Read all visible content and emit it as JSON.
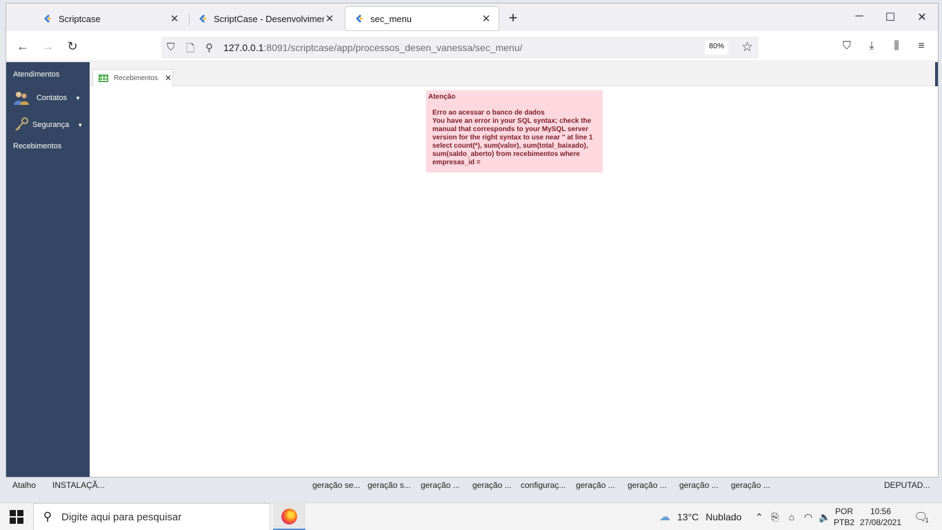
{
  "browser": {
    "tabs": [
      {
        "title": "Scriptcase"
      },
      {
        "title": "ScriptCase - Desenvolvimento -"
      },
      {
        "title": "sec_menu"
      }
    ],
    "url_host": "127.0.0.1",
    "url_path": ":8091/scriptcase/app/processos_desen_vanessa/sec_menu/",
    "zoom": "80%"
  },
  "sidebar": {
    "items": [
      {
        "label": "Atendimentos"
      },
      {
        "label": "Contatos"
      },
      {
        "label": "Segurança"
      },
      {
        "label": "Recebimentos"
      }
    ]
  },
  "app_tab": {
    "label": "Recebimentos"
  },
  "error": {
    "title": "Atenção",
    "line1": "Erro ao acessar o banco de dados",
    "line2": "You have an error in your SQL syntax; check the manual that corresponds to your MySQL server version for the right syntax to use near '' at line 1",
    "line3": "select count(*), sum(valor), sum(total_baixado), sum(saldo_aberto) from recebimentos where empresas_id ="
  },
  "desktop_icons": [
    {
      "label": "Atalho"
    },
    {
      "label": "INSTALAÇÃ..."
    },
    {
      "label": "geração se..."
    },
    {
      "label": "geração s..."
    },
    {
      "label": "geração ..."
    },
    {
      "label": "geração ..."
    },
    {
      "label": "configuraç..."
    },
    {
      "label": "geração ..."
    },
    {
      "label": "geração ..."
    },
    {
      "label": "geração ..."
    },
    {
      "label": "geração ..."
    },
    {
      "label": "DEPUTAD..."
    }
  ],
  "taskbar": {
    "search_placeholder": "Digite aqui para pesquisar",
    "weather_temp": "13°C",
    "weather_desc": "Nublado",
    "lang": "POR",
    "layout": "PTB2",
    "time": "10:56",
    "date": "27/08/2021",
    "notification_count": "1"
  }
}
